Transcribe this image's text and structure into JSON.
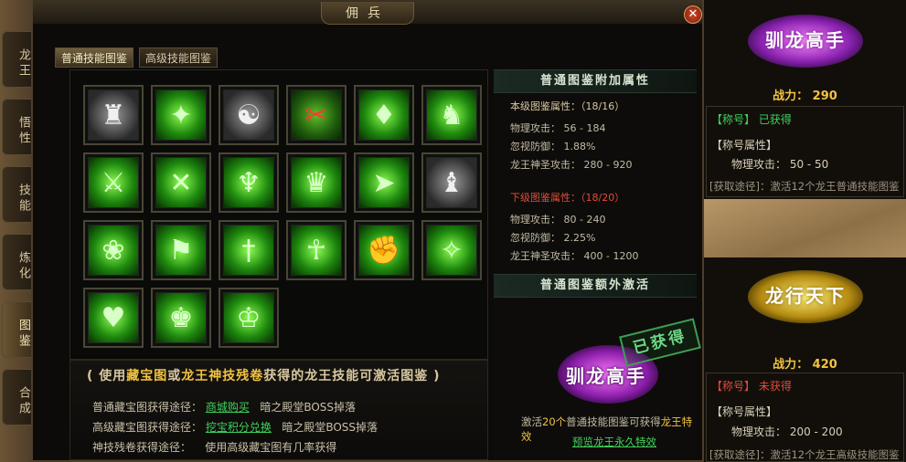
{
  "window": {
    "title": "佣兵",
    "close_label": "✕"
  },
  "side_tabs": [
    {
      "label": "龙王"
    },
    {
      "label": "悟性"
    },
    {
      "label": "技能"
    },
    {
      "label": "炼化"
    },
    {
      "label": "图鉴",
      "active": true
    },
    {
      "label": "合成"
    }
  ],
  "tabs": [
    {
      "label": "普通技能图鉴",
      "active": true
    },
    {
      "label": "高级技能图鉴",
      "active": false
    }
  ],
  "skills": [
    {
      "icon": "muscle-figure-icon",
      "style": "gray"
    },
    {
      "icon": "leaping-figure-icon",
      "style": "green"
    },
    {
      "icon": "meditating-figure-icon",
      "style": "gray"
    },
    {
      "icon": "blood-slash-icon",
      "style": "red"
    },
    {
      "icon": "crystal-shards-icon",
      "style": "green"
    },
    {
      "icon": "dragon-head-icon",
      "style": "green"
    },
    {
      "icon": "energy-blade-icon",
      "style": "green"
    },
    {
      "icon": "crossed-blades-icon",
      "style": "green"
    },
    {
      "icon": "demon-statue-icon",
      "style": "green"
    },
    {
      "icon": "flexing-giant-icon",
      "style": "green"
    },
    {
      "icon": "charging-figure-icon",
      "style": "green"
    },
    {
      "icon": "dark-warrior-icon",
      "style": "gray"
    },
    {
      "icon": "lotus-meditation-icon",
      "style": "green"
    },
    {
      "icon": "fighter-pair-icon",
      "style": "green"
    },
    {
      "icon": "giant-sword-icon",
      "style": "green"
    },
    {
      "icon": "praying-monk-icon",
      "style": "green"
    },
    {
      "icon": "fist-icon",
      "style": "green"
    },
    {
      "icon": "kicking-figure-icon",
      "style": "green"
    },
    {
      "icon": "heart-orb-icon",
      "style": "green"
    },
    {
      "icon": "beast-warrior-icon",
      "style": "green"
    },
    {
      "icon": "double-bicep-icon",
      "style": "green"
    }
  ],
  "tip": {
    "title_part1": "( 使用",
    "title_hl1": "藏宝图",
    "title_part2": "或",
    "title_hl2": "龙王神技残卷",
    "title_part3": "获得的龙王技能可激活图鉴 )"
  },
  "sources": [
    {
      "label": "普通藏宝图获得途径：",
      "link": "商城购买",
      "extra": "暗之殿堂BOSS掉落"
    },
    {
      "label": "高级藏宝图获得途径：",
      "link": "挖宝积分兑换",
      "extra": "暗之殿堂BOSS掉落"
    },
    {
      "label": "神技残卷获得途径：",
      "link": "",
      "extra": "使用高级藏宝图有几率获得"
    }
  ],
  "attr_section": {
    "heading": "普通图鉴附加属性",
    "current_label": "本级图鉴属性：（18/16）",
    "current": [
      "物理攻击：  56 - 184",
      "忽视防御：  1.88%",
      "龙王神圣攻击：  280 - 920"
    ],
    "next_label": "下级图鉴属性：（18/20）",
    "next": [
      "物理攻击：  80 - 240",
      "忽视防御：  2.25%",
      "龙王神圣攻击：  400 - 1200"
    ]
  },
  "extra_section": {
    "heading": "普通图鉴额外激活",
    "medal": "驯龙高手",
    "stamp": "已获得",
    "desc_part1": "激活",
    "desc_count": "20个",
    "desc_part2": "普通技能图鉴可获得",
    "desc_hl": "龙王特效",
    "preview_link": "预览龙王永久特效"
  },
  "cards": [
    {
      "medal": "驯龙高手",
      "power": "战力： 290",
      "title_tag": "【称号】",
      "title_state": "已获得",
      "attr_heading": "【称号属性】",
      "attr": "物理攻击：  50 - 50",
      "source": "[获取途径]：激活12个龙王普通技能图鉴"
    },
    {
      "medal": "龙行天下",
      "power": "战力： 420",
      "title_tag": "【称号】",
      "title_state": "未获得",
      "attr_heading": "【称号属性】",
      "attr": "物理攻击：  200 - 200",
      "source": "[获取途径]：激活12个龙王高级技能图鉴"
    }
  ],
  "colors": {
    "gold": "#f2c340",
    "link_green": "#3fd25a",
    "obtained_green": "#3fd25a",
    "missing_red": "#e04c3a"
  }
}
